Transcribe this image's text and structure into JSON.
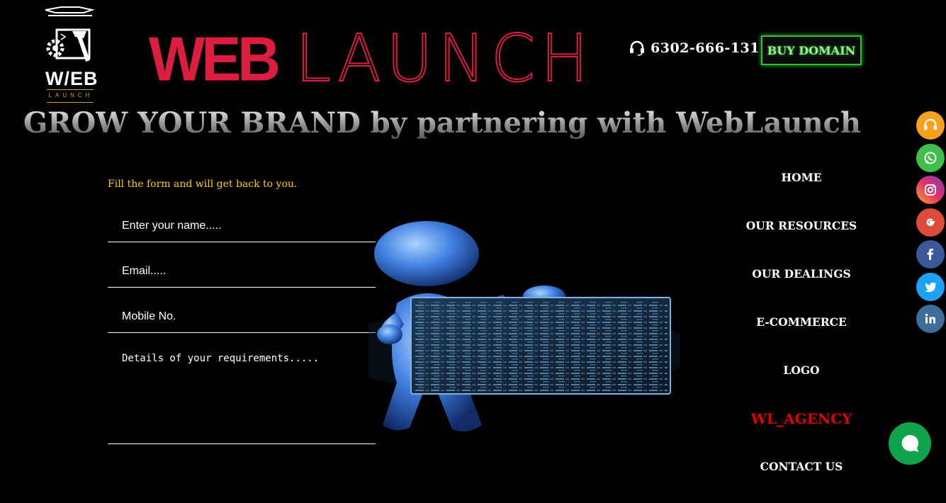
{
  "header": {
    "logo": {
      "text": "W/EB",
      "subtext": "LAUNCH"
    },
    "brand": {
      "word1": "WEB",
      "word2": "LAUNCH"
    },
    "phone": {
      "number": "6302-666-131",
      "icon": "headset-icon"
    },
    "buy_domain_label": "BUY DOMAIN"
  },
  "tagline": "GROW YOUR BRAND by partnering with WebLaunch",
  "form": {
    "intro": "Fill the form and will get back to you.",
    "name_placeholder": "Enter your name.....",
    "email_placeholder": "Email.....",
    "mobile_placeholder": "Mobile No.",
    "details_placeholder": "Details of your requirements....."
  },
  "nav": {
    "items": [
      {
        "label": "HOME"
      },
      {
        "label": "OUR RESOURCES"
      },
      {
        "label": "OUR DEALINGS"
      },
      {
        "label": "E-COMMERCE"
      },
      {
        "label": "LOGO"
      },
      {
        "label": "WL_AGENCY"
      },
      {
        "label": "CONTACT US"
      }
    ]
  },
  "social": [
    {
      "icon": "headset-icon",
      "color": "#f7a11a"
    },
    {
      "icon": "whatsapp-icon",
      "color": "#3ec04b"
    },
    {
      "icon": "instagram-icon",
      "color": "#c13584"
    },
    {
      "icon": "google-icon",
      "color": "#dd4b39"
    },
    {
      "icon": "facebook-icon",
      "color": "#3b5998"
    },
    {
      "icon": "twitter-icon",
      "color": "#1da1f2"
    },
    {
      "icon": "linkedin-icon",
      "color": "#3c6e9a"
    }
  ],
  "chat": {
    "icon": "chat-bubble-icon",
    "color": "#0fa34b"
  },
  "colors": {
    "brand_red": "#dd1d3f",
    "form_intro": "#ffcc00",
    "buy_domain_border": "#2fbf2f",
    "agency_link": "#e00000"
  }
}
